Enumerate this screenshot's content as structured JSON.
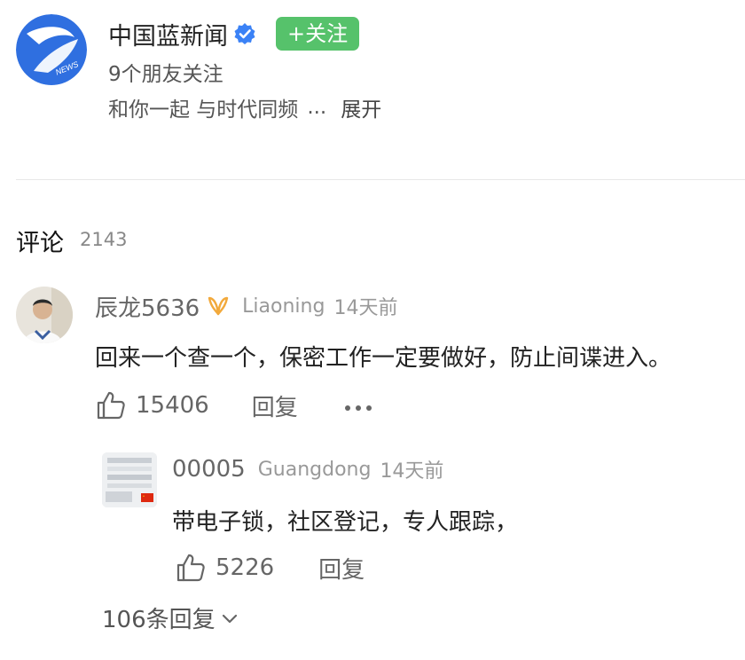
{
  "publisher": {
    "name": "中国蓝新闻",
    "follow_label": "+关注",
    "followers_text": "9个朋友关注",
    "description": "和你一起 与时代同频",
    "description_ellipsis": "...",
    "expand_label": "展开",
    "logo_text": "NEWS",
    "icons": {
      "verified": "verified-check-icon"
    },
    "colors": {
      "follow_button": "#56c26b",
      "verified": "#3b82f6",
      "logo_blue": "#2f6fe0"
    }
  },
  "comments_section": {
    "title": "评论",
    "count": "2143"
  },
  "comments": [
    {
      "username": "辰龙5636",
      "badge_icon": "gold-badge-icon",
      "location": "Liaoning",
      "time": "14天前",
      "text": "回来一个查一个，保密工作一定要做好，防止间谍进入。",
      "likes": "15406",
      "reply_label": "回复",
      "more_icon": "more-dots-icon",
      "replies": [
        {
          "username": "00005",
          "location": "Guangdong",
          "time": "14天前",
          "text": "带电子锁，社区登记，专人跟踪，",
          "likes": "5226",
          "reply_label": "回复"
        }
      ],
      "more_replies_label": "106条回复"
    }
  ]
}
